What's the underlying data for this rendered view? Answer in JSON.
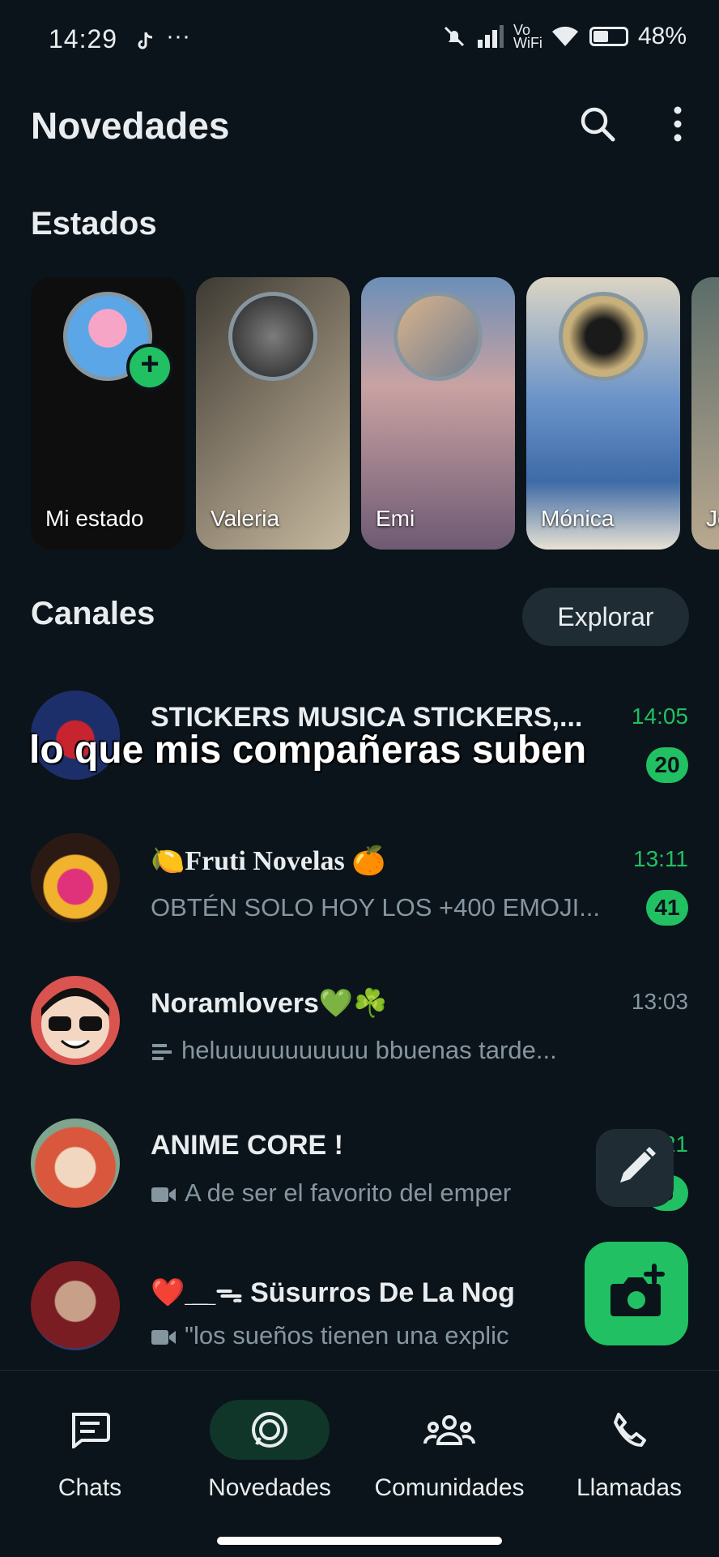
{
  "status_bar": {
    "time": "14:29",
    "dots": "···",
    "vowifi": "Vo WiFi",
    "battery": "48%",
    "battery_level": 0.48
  },
  "header": {
    "title": "Novedades"
  },
  "statuses": {
    "title": "Estados",
    "items": [
      {
        "label": "Mi estado"
      },
      {
        "label": "Valeria"
      },
      {
        "label": "Emi"
      },
      {
        "label": "Mónica"
      },
      {
        "label": "Jo"
      }
    ]
  },
  "channels": {
    "title": "Canales",
    "explore_label": "Explorar",
    "items": [
      {
        "name": "STICKERS  MUSICA  STICKERS,...",
        "time": "14:05",
        "preview": "",
        "badge": "20"
      },
      {
        "name": "🍋Fruti Novelas 🍊",
        "time": "13:11",
        "preview": "OBTÉN SOLO HOY LOS +400 EMOJI...",
        "badge": "41"
      },
      {
        "name": "Noramlovers💚☘️",
        "time": "13:03",
        "preview": "heluuuuuuuuuuu bbuenas tarde...",
        "badge": ""
      },
      {
        "name": "ANIME CORE !",
        "time": "21",
        "preview": "A de ser el favorito del emper",
        "badge": "5"
      },
      {
        "name": "❤️ ̲ ̲̲ ̲ ᯓ Süsurros De La Nog",
        "time": "",
        "preview": "\"los sueños tienen una explic",
        "badge": ""
      }
    ]
  },
  "overlay_caption": "lo que mis compañeras suben",
  "bottom_nav": [
    {
      "label": "Chats",
      "active": false
    },
    {
      "label": "Novedades",
      "active": true
    },
    {
      "label": "Comunidades",
      "active": false
    },
    {
      "label": "Llamadas",
      "active": false
    }
  ],
  "colors": {
    "background": "#0b141a",
    "accent": "#21c063",
    "muted": "#8696a0"
  }
}
